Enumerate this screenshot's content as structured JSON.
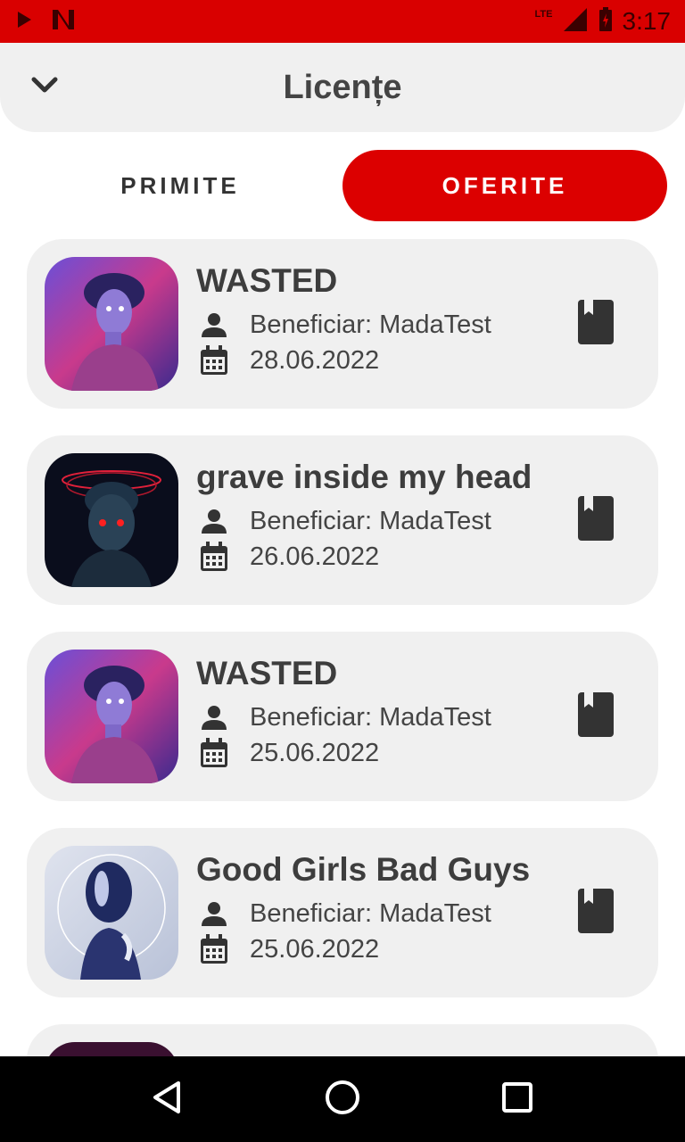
{
  "status_bar": {
    "time": "3:17",
    "network": "LTE",
    "accent": "#d90000"
  },
  "header": {
    "title": "Licențe",
    "back_icon": "chevron-down-icon"
  },
  "tabs": [
    {
      "label": "PRIMITE",
      "active": false
    },
    {
      "label": "OFERITE",
      "active": true
    }
  ],
  "licenses": [
    {
      "title": "WASTED",
      "beneficiary": "Beneficiar: MadaTest",
      "date": "28.06.2022",
      "art": "statue-pink"
    },
    {
      "title": "grave inside my head",
      "beneficiary": "Beneficiar: MadaTest",
      "date": "26.06.2022",
      "art": "bust-dark"
    },
    {
      "title": "WASTED",
      "beneficiary": "Beneficiar: MadaTest",
      "date": "25.06.2022",
      "art": "statue-pink"
    },
    {
      "title": "Good Girls Bad Guys",
      "beneficiary": "Beneficiar: MadaTest",
      "date": "25.06.2022",
      "art": "chrome-figure"
    }
  ],
  "colors": {
    "active_tab": "#dc0000",
    "card_bg": "#f0f0f0",
    "text": "#3d3d3d"
  }
}
